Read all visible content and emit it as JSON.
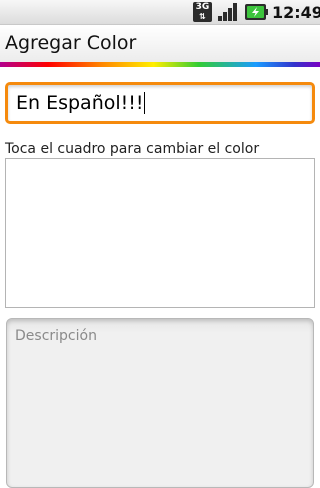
{
  "status_bar": {
    "network_label": "3G",
    "network_icon": "3g-data-icon",
    "signal_icon": "signal-strength-icon",
    "battery_icon": "battery-charging-icon",
    "time": "12:49"
  },
  "title_bar": {
    "title": "Agregar Color"
  },
  "colors": {
    "focus_border": "#f58a0d",
    "battery_charge": "#3cc43c"
  },
  "form": {
    "name_value": "En Español!!!",
    "color_hint": "Toca el cuadro para cambiar el color",
    "description_placeholder": "Descripción",
    "description_value": ""
  }
}
